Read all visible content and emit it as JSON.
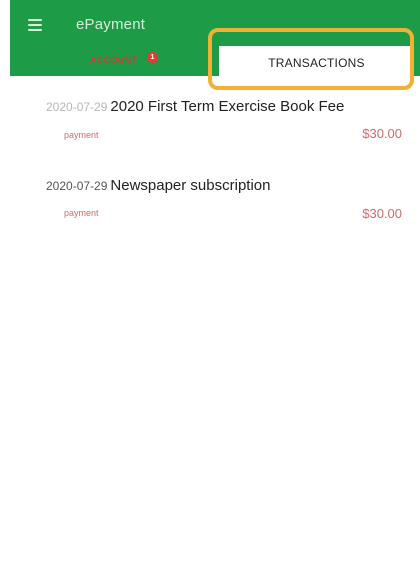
{
  "app": {
    "title": "ePayment"
  },
  "tabs": {
    "left_label": "ACCOUNT",
    "left_badge": "1",
    "right_label": "TRANSACTIONS"
  },
  "transactions": [
    {
      "date": "2020-07-29",
      "title": "2020 First Term Exercise Book Fee",
      "type": "payment",
      "amount": "$30.00"
    },
    {
      "date": "2020-07-29",
      "title": "Newspaper subscription",
      "type": "payment",
      "amount": "$30.00"
    }
  ],
  "colors": {
    "appbar": "#1e9b46",
    "highlight": "#f2b134",
    "amount": "#d36a6a"
  },
  "icons": {
    "menu": "hamburger-menu-icon"
  }
}
